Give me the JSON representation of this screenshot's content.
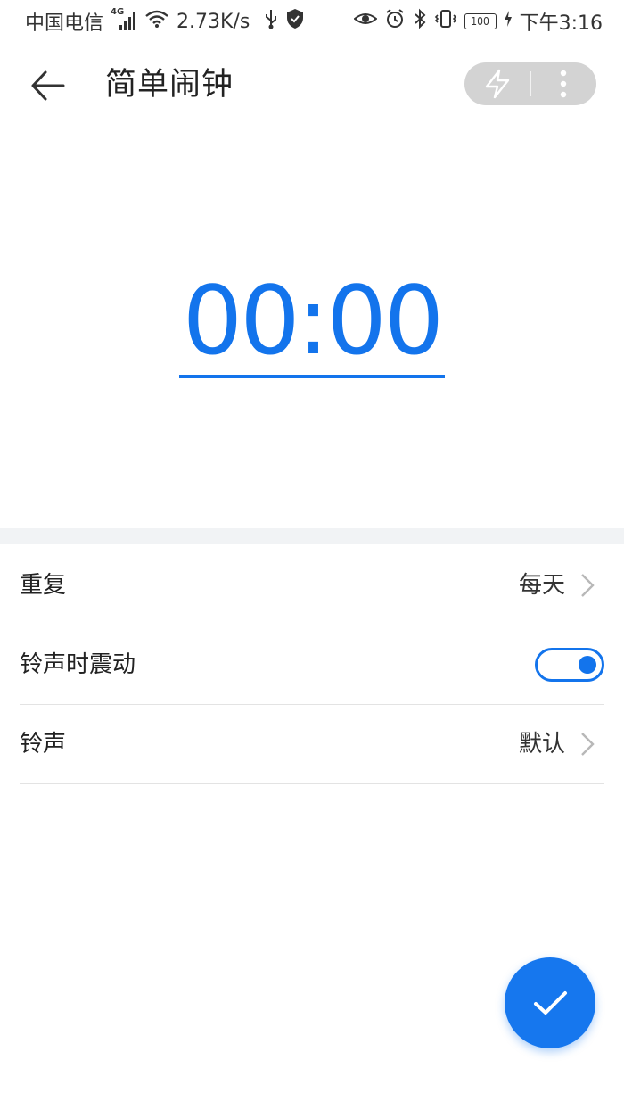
{
  "status_bar": {
    "carrier": "中国电信",
    "network_type": "4G",
    "speed": "2.73K/s",
    "battery_level": "100",
    "clock": "下午3:16",
    "icons": [
      "signal-icon",
      "wifi-icon",
      "usb-icon",
      "shield-icon",
      "eye-icon",
      "alarm-icon",
      "bluetooth-icon",
      "vibrate-icon",
      "battery-icon",
      "charging-icon"
    ]
  },
  "app_bar": {
    "title": "简单闹钟",
    "icons": [
      "back-arrow-icon",
      "flash-icon",
      "more-vert-icon"
    ]
  },
  "alarm": {
    "time": "00:00"
  },
  "settings": {
    "repeat": {
      "label": "重复",
      "value": "每天"
    },
    "vibrate": {
      "label": "铃声时震动",
      "enabled": true
    },
    "ringtone": {
      "label": "铃声",
      "value": "默认"
    }
  },
  "fab": {
    "icon": "check-icon"
  },
  "colors": {
    "accent": "#1374ec",
    "separator_band": "#f1f3f5",
    "capsule_bg": "#d3d3d3"
  }
}
